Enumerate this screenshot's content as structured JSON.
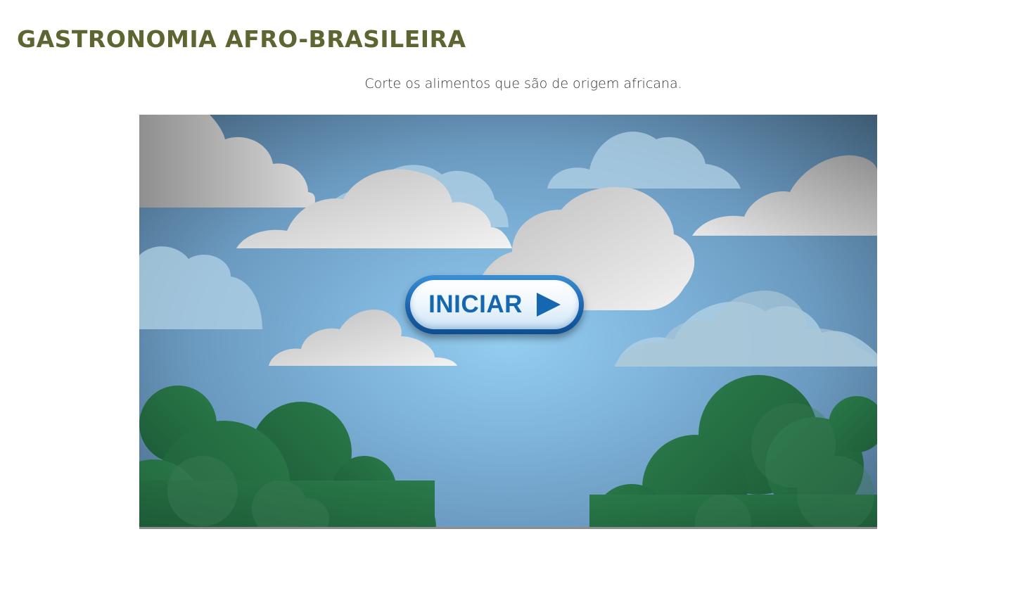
{
  "page": {
    "title": "GASTRONOMIA AFRO-BRASILEIRA",
    "instructions": "Corte os alimentos que são de origem africana."
  },
  "game": {
    "start_button_label": "INICIAR",
    "start_button_icon": "play-triangle-icon",
    "colors": {
      "title": "#5f6530",
      "sky_center": "#93cdf0",
      "sky_edge": "#3d5a72",
      "button_blue": "#1467b0",
      "foliage": "#26704a"
    }
  }
}
